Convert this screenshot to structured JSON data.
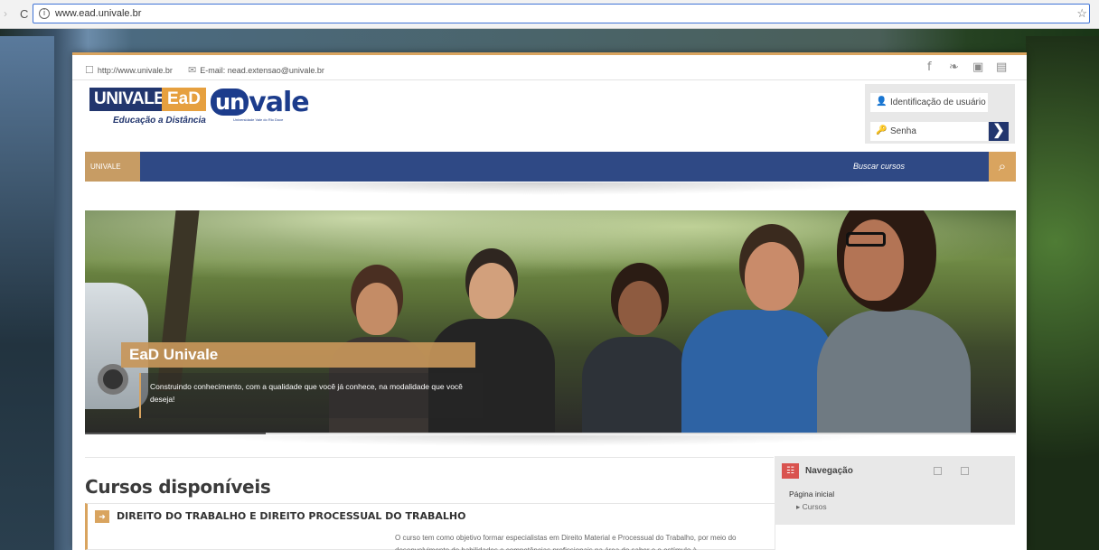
{
  "browser": {
    "url": "www.ead.univale.br"
  },
  "topbar": {
    "website": "http://www.univale.br",
    "email": "E-mail: nead.extensao@univale.br",
    "social": [
      {
        "icon": "facebook-icon",
        "glyph": "f"
      },
      {
        "icon": "twitter-icon",
        "glyph": "❧"
      },
      {
        "icon": "instagram-icon",
        "glyph": "▣"
      },
      {
        "icon": "youtube-icon",
        "glyph": "▤"
      }
    ]
  },
  "logo": {
    "univale": "UNIVALE",
    "ead": "EaD",
    "subtitle": "Educação a Distância",
    "brand_un": "un",
    "brand_vale": "vale",
    "brand_sub": "Universidade Vale do Rio Doce"
  },
  "login": {
    "username_placeholder": "Identificação de usuário",
    "password_placeholder": "Senha",
    "submit_glyph": "❯"
  },
  "nav": {
    "home": "UNIVALE",
    "search_label": "Buscar cursos"
  },
  "hero": {
    "title": "EaD Univale",
    "text": "Construindo conhecimento, com a qualidade que você já conhece, na modalidade que você deseja!"
  },
  "courses": {
    "heading": "Cursos disponíveis",
    "items": [
      {
        "title": "DIREITO DO TRABALHO E DIREITO PROCESSUAL DO TRABALHO",
        "description": "O curso tem como objetivo formar especialistas em Direito Material e Processual do Trabalho, por meio do desenvolvimento de habilidades e competências profissionais na área do saber e o estímulo à"
      }
    ]
  },
  "navigation_block": {
    "title": "Navegação",
    "home": "Página inicial",
    "courses": "Cursos"
  },
  "colors": {
    "accent": "#d9a45f",
    "navy": "#2f4985"
  }
}
